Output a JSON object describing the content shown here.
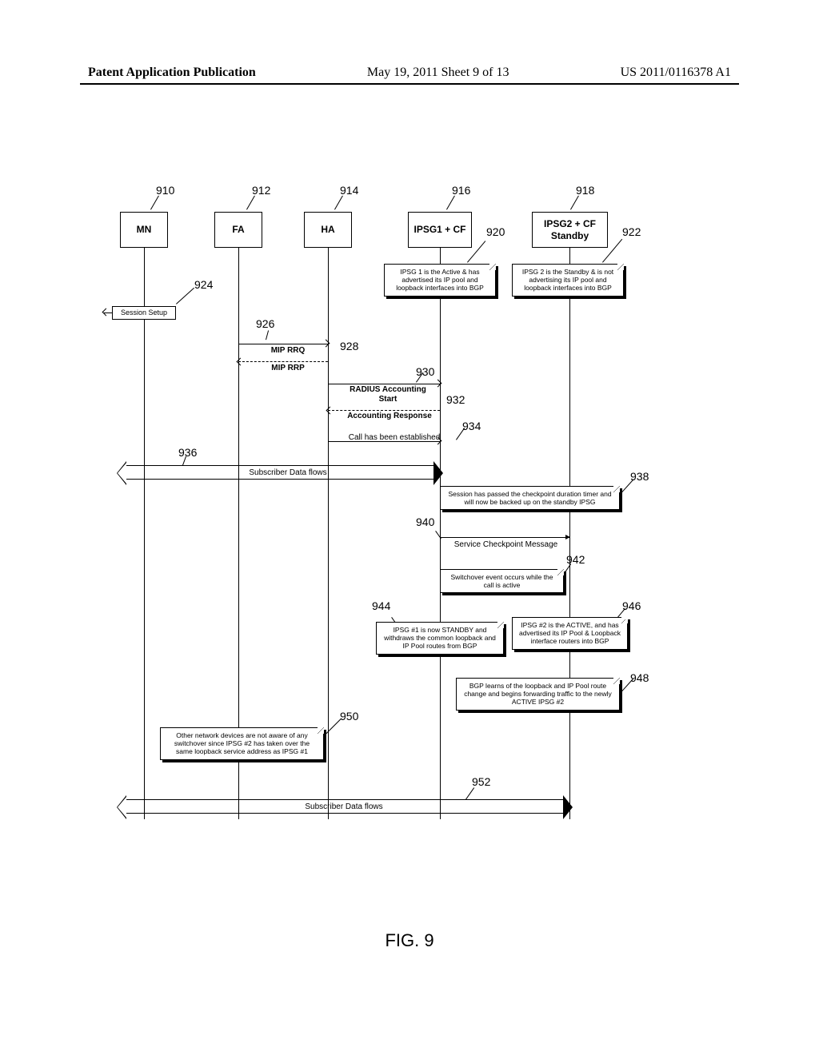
{
  "header": {
    "left": "Patent Application Publication",
    "center": "May 19, 2011  Sheet 9 of 13",
    "right": "US 2011/0116378 A1"
  },
  "participants": {
    "p1": "MN",
    "p2": "FA",
    "p3": "HA",
    "p4": "IPSG1 + CF",
    "p5": "IPSG2 + CF Standby"
  },
  "refs": {
    "r910": "910",
    "r912": "912",
    "r914": "914",
    "r916": "916",
    "r918": "918",
    "r920": "920",
    "r922": "922",
    "r924": "924",
    "r926": "926",
    "r928": "928",
    "r930": "930",
    "r932": "932",
    "r934": "934",
    "r936": "936",
    "r938": "938",
    "r940": "940",
    "r942": "942",
    "r944": "944",
    "r946": "946",
    "r948": "948",
    "r950": "950",
    "r952": "952"
  },
  "notes": {
    "n920": "IPSG 1 is the Active & has advertised its IP pool and loopback interfaces into BGP",
    "n922": "IPSG 2 is the Standby & is not advertising its IP pool and loopback interfaces into BGP",
    "n938": "Session has passed the checkpoint duration timer and will now be backed up on the standby IPSG",
    "n942": "Switchover event occurs while the call is active",
    "n944": "IPSG #1 is now STANDBY and withdraws the common loopback and IP Pool routes from BGP",
    "n946": "IPSG #2 is the ACTIVE, and has advertised its IP Pool & Loopback interface routers into BGP",
    "n948": "BGP learns of the loopback and IP Pool route change and begins forwarding traffic to the newly ACTIVE IPSG #2",
    "n950": "Other network devices are not aware of any switchover since IPSG #2 has taken over the same loopback service address as IPSG #1"
  },
  "messages": {
    "m924": "Session Setup",
    "m926": "MIP RRQ",
    "m928": "MIP RRP",
    "m930": "RADIUS Accounting Start",
    "m932": "Accounting Response",
    "m934": "Call has been established",
    "m936": "Subscriber Data flows",
    "m940": "Service Checkpoint Message",
    "m952": "Subscriber Data flows"
  },
  "figure_caption": "FIG. 9"
}
